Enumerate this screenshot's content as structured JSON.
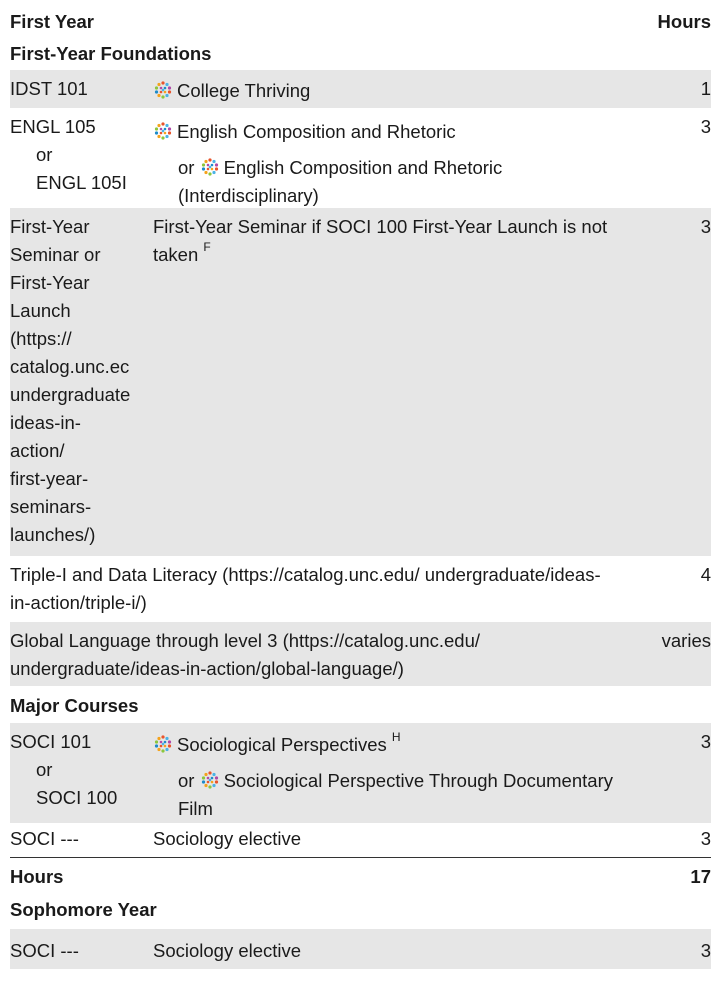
{
  "header": {
    "first_year": "First Year",
    "hours": "Hours"
  },
  "sections": {
    "foundations": "First-Year Foundations",
    "major": "Major Courses",
    "sophomore": "Sophomore Year"
  },
  "rows": {
    "idst": {
      "code": "IDST 101",
      "title": "College Thriving",
      "hours": "1"
    },
    "engl": {
      "code": "ENGL 105",
      "or": "or",
      "code_alt": "ENGL 105I",
      "title": "English Composition and Rhetoric",
      "or_prefix": "or",
      "title_alt": "English Composition and Rhetoric (Interdisciplinary)",
      "hours": "3"
    },
    "fys": {
      "code_lines": [
        "First-Year",
        "Seminar or",
        "First-Year",
        "Launch",
        "(https://",
        "catalog.unc.ec",
        "undergraduate",
        "ideas-in-",
        "action/",
        "first-year-",
        "seminars-",
        "launches/)"
      ],
      "title": "First-Year Seminar if SOCI 100 First-Year Launch is not taken",
      "footnote": "F",
      "hours": "3"
    },
    "triple": {
      "text": "Triple-I and Data Literacy (https://catalog.unc.edu/ undergraduate/ideas-in-action/triple-i/)",
      "hours": "4"
    },
    "global": {
      "text": "Global Language through level 3 (https://catalog.unc.edu/ undergraduate/ideas-in-action/global-language/)",
      "hours": "varies"
    },
    "soci101": {
      "code": "SOCI 101",
      "or": "or",
      "code_alt": "SOCI 100",
      "title": "Sociological Perspectives",
      "footnote": "H",
      "or_prefix": "or",
      "title_alt": "Sociological Perspective Through Documentary Film",
      "hours": "3"
    },
    "elective1": {
      "code": "SOCI ---",
      "title": "Sociology elective",
      "hours": "3"
    },
    "elective2": {
      "code": "SOCI ---",
      "title": "Sociology elective",
      "hours": "3"
    }
  },
  "total": {
    "label": "Hours",
    "value": "17"
  },
  "icon": {
    "name": "ideas-in-action-icon",
    "colors": [
      "#e8542c",
      "#f4a31c",
      "#4bb3e6",
      "#8cc63e",
      "#b04aa8",
      "#1d8bc9"
    ]
  }
}
